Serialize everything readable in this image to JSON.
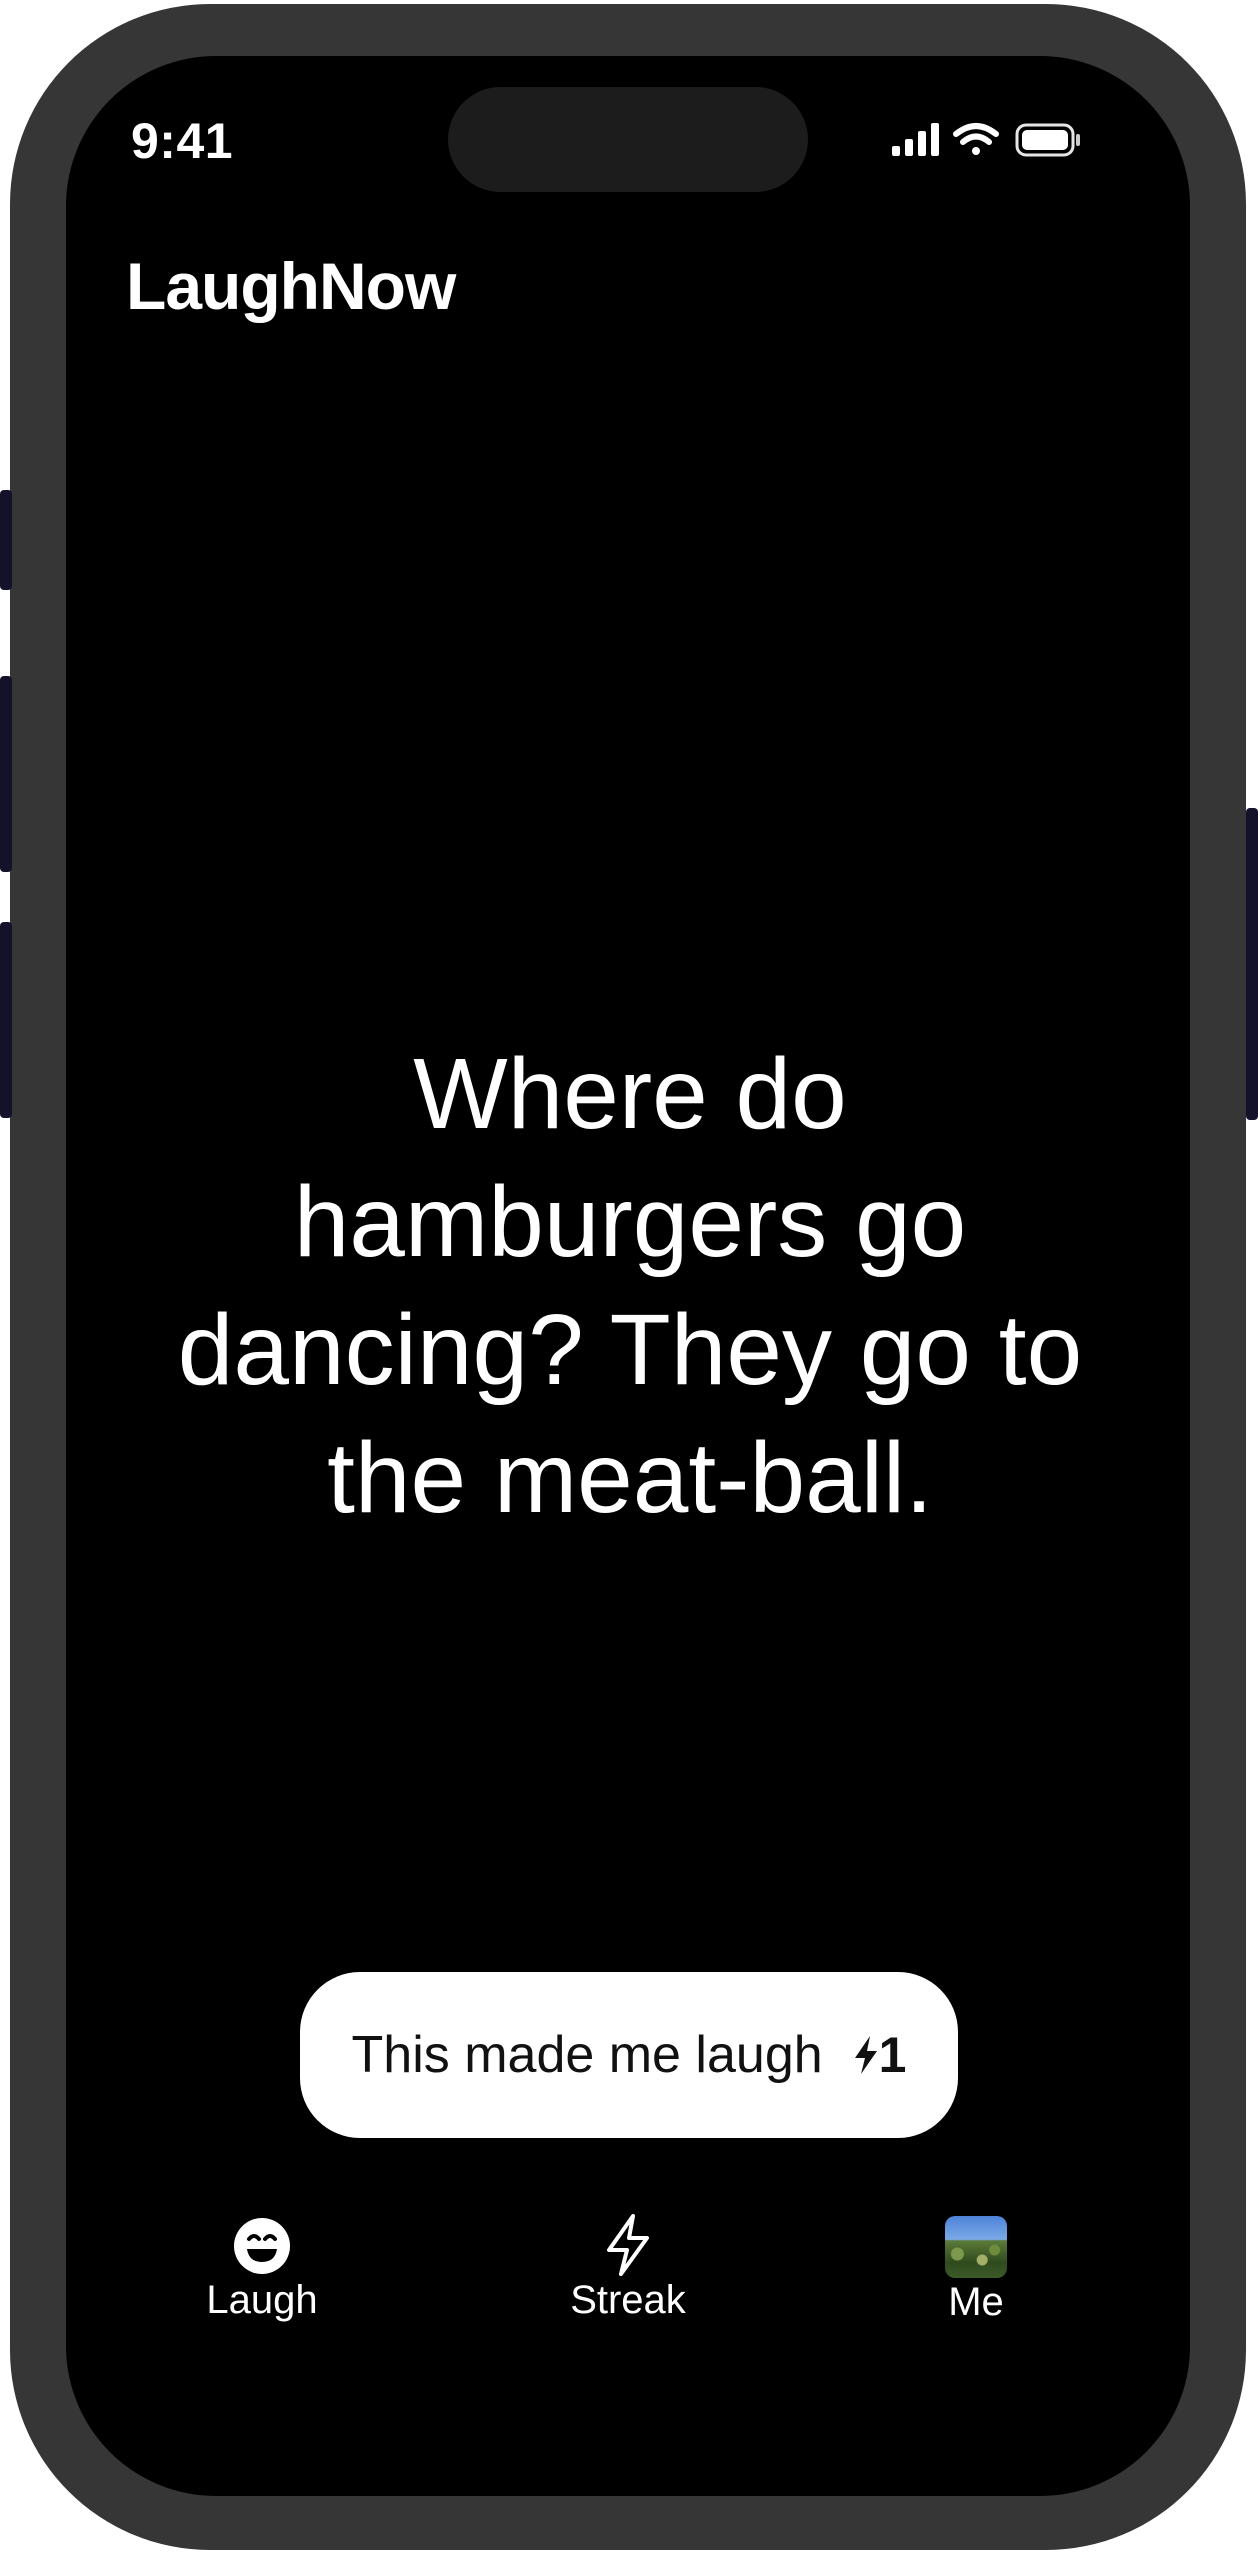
{
  "status_bar": {
    "time": "9:41"
  },
  "header": {
    "app_title": "LaughNow"
  },
  "joke": {
    "text": "Where do hamburgers go dancing? They go to the meat-ball."
  },
  "action": {
    "laugh_label": "This made me laugh",
    "delta": "1"
  },
  "nav": {
    "items": [
      {
        "label": "Laugh",
        "icon": "smiley-icon"
      },
      {
        "label": "Streak",
        "icon": "lightning-icon"
      },
      {
        "label": "Me",
        "icon": "avatar-image"
      }
    ]
  }
}
